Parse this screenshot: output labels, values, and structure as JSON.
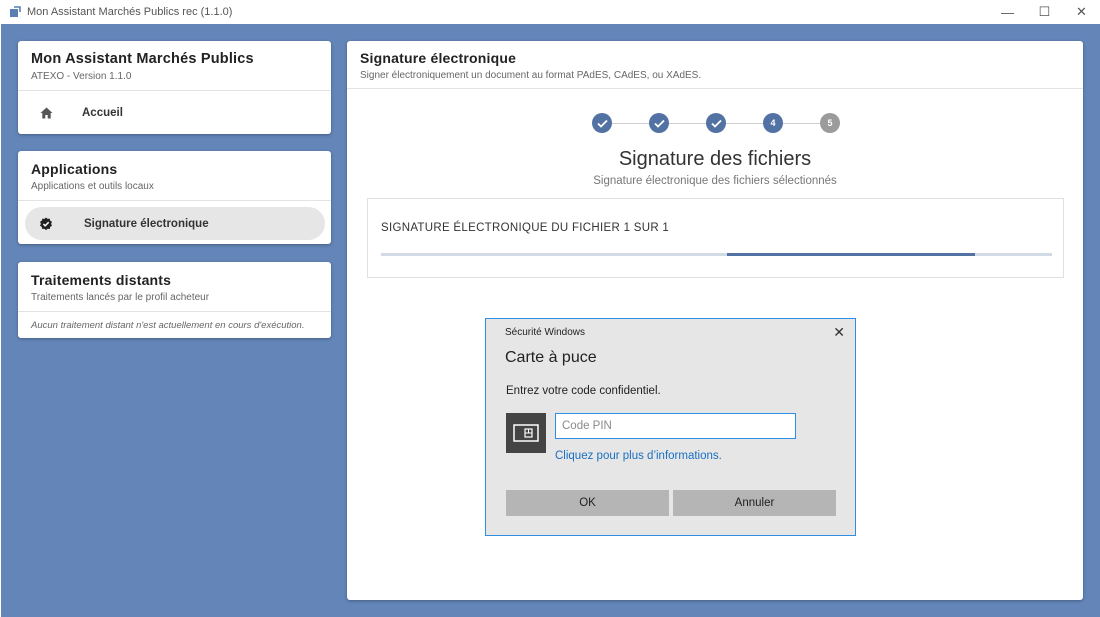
{
  "window": {
    "title": "Mon Assistant Marchés Publics rec (1.1.0)",
    "minimize_glyph": "—",
    "maximize_glyph": "☐",
    "close_glyph": "✕"
  },
  "sidebar": {
    "home": {
      "title": "Mon Assistant Marchés Publics",
      "subtitle": "ATEXO - Version 1.1.0",
      "item_label": "Accueil",
      "item_icon": "home-icon"
    },
    "apps": {
      "title": "Applications",
      "subtitle": "Applications et outils locaux",
      "item_label": "Signature électronique",
      "item_icon": "verified-badge-icon"
    },
    "remote": {
      "title": "Traitements distants",
      "subtitle": "Traitements lancés par le profil acheteur",
      "empty_message": "Aucun traitement distant n'est actuellement en cours d'exécution."
    }
  },
  "panel": {
    "title": "Signature électronique",
    "subtitle": "Signer électroniquement un document au format PAdES, CAdES, ou XAdES.",
    "steps": [
      {
        "label": "",
        "state": "done"
      },
      {
        "label": "",
        "state": "done"
      },
      {
        "label": "",
        "state": "done"
      },
      {
        "label": "4",
        "state": "active"
      },
      {
        "label": "5",
        "state": "pending"
      }
    ],
    "step_title": "Signature des fichiers",
    "step_subtitle": "Signature électronique des fichiers sélectionnés",
    "progress_label": "SIGNATURE ÉLECTRONIQUE DU FICHIER 1 SUR 1",
    "progress": {
      "indeterminate": true,
      "segment_start": 0.516,
      "segment_end": 0.885
    }
  },
  "dialog": {
    "caption": "Sécurité Windows",
    "heading": "Carte à puce",
    "prompt": "Entrez votre code confidentiel.",
    "pin_placeholder": "Code PIN",
    "pin_value": "",
    "link": "Cliquez pour plus d’informations.",
    "ok_label": "OK",
    "cancel_label": "Annuler",
    "close_glyph": "✕"
  },
  "colors": {
    "background": "#6385b8",
    "accent": "#5272a3",
    "pending": "#9b9b9b",
    "dialog_border": "#2f8de4",
    "link": "#1a6fc2"
  }
}
